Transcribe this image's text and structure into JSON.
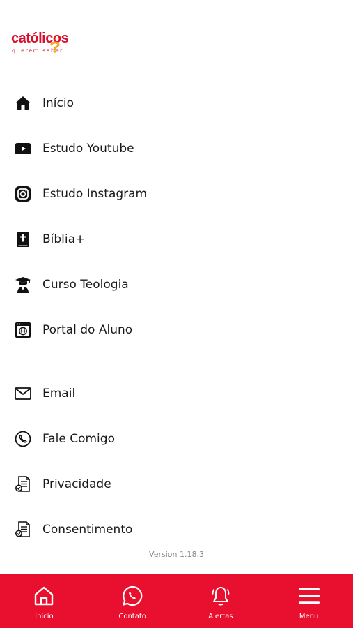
{
  "brand": {
    "name": "católicos",
    "tagline": "querem saber",
    "color": "#d8102d",
    "accent": "#f5a623"
  },
  "menu": {
    "primary": [
      {
        "label": "Início",
        "icon": "home-icon"
      },
      {
        "label": "Estudo Youtube",
        "icon": "youtube-icon"
      },
      {
        "label": "Estudo Instagram",
        "icon": "instagram-icon"
      },
      {
        "label": "Bíblia+",
        "icon": "bible-icon"
      },
      {
        "label": "Curso Teologia",
        "icon": "graduate-icon"
      },
      {
        "label": "Portal do Aluno",
        "icon": "web-portal-icon"
      }
    ],
    "secondary": [
      {
        "label": "Email",
        "icon": "mail-icon"
      },
      {
        "label": "Fale Comigo",
        "icon": "phone-icon"
      },
      {
        "label": "Privacidade",
        "icon": "document-icon"
      },
      {
        "label": "Consentimento",
        "icon": "document-icon"
      }
    ]
  },
  "version": "Version 1.18.3",
  "tabbar": {
    "color": "#e8102e",
    "tabs": [
      {
        "label": "Início",
        "icon": "home-outline-icon"
      },
      {
        "label": "Contato",
        "icon": "whatsapp-icon"
      },
      {
        "label": "Alertas",
        "icon": "bell-icon"
      },
      {
        "label": "Menu",
        "icon": "hamburger-icon"
      }
    ]
  }
}
